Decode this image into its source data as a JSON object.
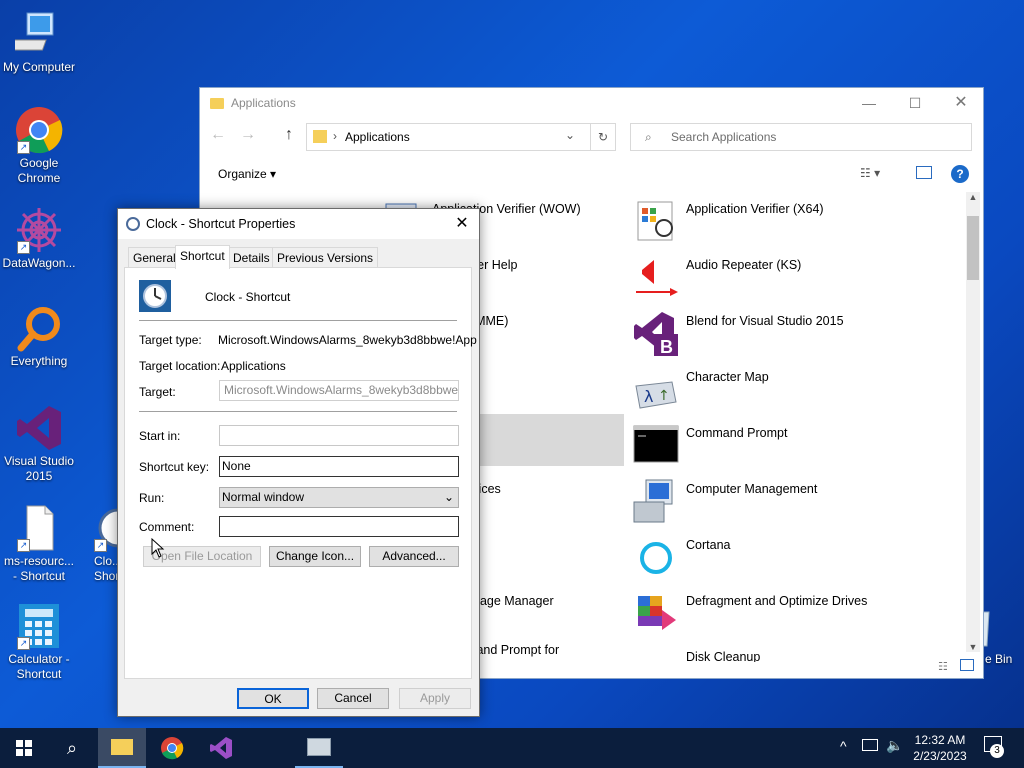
{
  "desktop": {
    "icons": [
      {
        "label": "My Computer",
        "icon": "computer-icon"
      },
      {
        "label": "Google Chrome",
        "icon": "chrome-icon"
      },
      {
        "label": "DataWagon...",
        "icon": "datawagon-icon"
      },
      {
        "label": "Everything",
        "icon": "everything-search-icon"
      },
      {
        "label": "Visual Studio 2015",
        "icon": "visual-studio-icon"
      },
      {
        "label": "ms-resourc... - Shortcut",
        "icon": "document-icon"
      },
      {
        "label": "Clo... Shor...",
        "icon": "clock-icon"
      },
      {
        "label": "Calculator - Shortcut",
        "icon": "calculator-icon"
      },
      {
        "label": "e Bin",
        "icon": "recycle-bin-icon"
      }
    ]
  },
  "explorer": {
    "title": "Applications",
    "address": "Applications",
    "search_placeholder": "Search Applications",
    "organize": "Organize",
    "apps_left": [
      "Application Verifier (WOW)",
      "on Verifier Help",
      "peater (MME)",
      "",
      "",
      "ent Services",
      "anel",
      "ble Package Manager",
      "r Command Prompt for"
    ],
    "apps_right": [
      {
        "name": "Application Verifier (X64)",
        "icon": "app-verifier-icon"
      },
      {
        "name": "Audio Repeater (KS)",
        "icon": "audio-repeater-icon"
      },
      {
        "name": "Blend for Visual Studio 2015",
        "icon": "blend-icon"
      },
      {
        "name": "Character Map",
        "icon": "character-map-icon"
      },
      {
        "name": "Command Prompt",
        "icon": "command-prompt-icon"
      },
      {
        "name": "Computer Management",
        "icon": "computer-management-icon"
      },
      {
        "name": "Cortana",
        "icon": "cortana-icon"
      },
      {
        "name": "Defragment and Optimize Drives",
        "icon": "defragment-icon"
      },
      {
        "name": "Disk Cleanup",
        "icon": "disk-cleanup-icon"
      }
    ]
  },
  "dialog": {
    "title": "Clock - Shortcut Properties",
    "tabs": [
      "General",
      "Shortcut",
      "Details",
      "Previous Versions"
    ],
    "shortcut_name": "Clock - Shortcut",
    "target_type_label": "Target type:",
    "target_type": "Microsoft.WindowsAlarms_8wekyb3d8bbwe!App",
    "target_location_label": "Target location:",
    "target_location": "Applications",
    "target_label": "Target:",
    "target": "Microsoft.WindowsAlarms_8wekyb3d8bbwe!App",
    "start_in_label": "Start in:",
    "start_in": "",
    "shortcut_key_label": "Shortcut key:",
    "shortcut_key": "None",
    "run_label": "Run:",
    "run": "Normal window",
    "comment_label": "Comment:",
    "comment": "",
    "open_file_location": "Open File Location",
    "change_icon": "Change Icon...",
    "advanced": "Advanced...",
    "ok": "OK",
    "cancel": "Cancel",
    "apply": "Apply"
  },
  "taskbar": {
    "time": "12:32 AM",
    "date": "2/23/2023",
    "notifications": "3"
  }
}
